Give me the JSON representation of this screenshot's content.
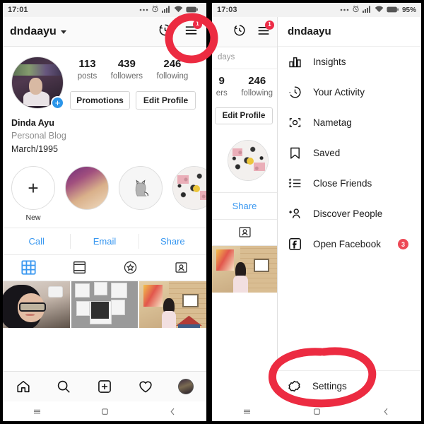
{
  "left_phone": {
    "status_bar": {
      "time": "17:01",
      "icons": [
        "dots-icon",
        "alarm-icon",
        "signal-icon",
        "wifi-icon",
        "battery-icon"
      ],
      "battery_pct": ""
    },
    "app_bar": {
      "username": "dndaayu",
      "caret_icon": "chevron-down-icon",
      "history_icon": "clock-history-icon",
      "menu_icon": "hamburger-menu-icon",
      "menu_badge": "1"
    },
    "profile": {
      "avatar_icon": "profile-avatar",
      "add_story_badge": "+",
      "stats": [
        {
          "value": "113",
          "label": "posts"
        },
        {
          "value": "439",
          "label": "followers"
        },
        {
          "value": "246",
          "label": "following"
        }
      ],
      "buttons": [
        {
          "label": "Promotions"
        },
        {
          "label": "Edit Profile"
        }
      ],
      "display_name": "Dinda Ayu",
      "category": "Personal Blog",
      "bio": "March/1995"
    },
    "highlights": [
      {
        "label": "New",
        "kind": "new"
      },
      {
        "label": "",
        "kind": "photo-purple"
      },
      {
        "label": "",
        "kind": "cat-drawing"
      },
      {
        "label": "",
        "kind": "speckle-collage"
      },
      {
        "label": "",
        "kind": "speckle-collage"
      }
    ],
    "contact_buttons": [
      {
        "label": "Call"
      },
      {
        "label": "Email"
      },
      {
        "label": "Share"
      }
    ],
    "tabs": [
      {
        "icon": "grid-icon",
        "active": true
      },
      {
        "icon": "feed-list-icon",
        "active": false
      },
      {
        "icon": "star-badge-icon",
        "active": false
      },
      {
        "icon": "tagged-person-icon",
        "active": false
      }
    ],
    "grid_posts": [
      {
        "alt": "selfie-photo",
        "has_multi_badge": true
      },
      {
        "alt": "polaroid-wall-photo",
        "has_multi_badge": false
      },
      {
        "alt": "gallery-room-photo",
        "has_multi_badge": false
      }
    ],
    "bottom_nav": [
      {
        "icon": "home-icon"
      },
      {
        "icon": "search-icon"
      },
      {
        "icon": "add-post-icon"
      },
      {
        "icon": "heart-activity-icon"
      },
      {
        "icon": "profile-avatar-icon"
      }
    ],
    "system_nav": [
      {
        "icon": "recents-icon"
      },
      {
        "icon": "home-square-icon"
      },
      {
        "icon": "back-icon"
      }
    ]
  },
  "right_phone": {
    "status_bar": {
      "time": "17:03",
      "icons": [
        "dots-icon",
        "alarm-icon",
        "signal-icon",
        "wifi-icon",
        "battery-icon"
      ],
      "battery_pct": "95%"
    },
    "peek": {
      "history_icon": "clock-history-icon",
      "menu_icon": "hamburger-menu-icon",
      "menu_badge": "1",
      "days_text": "days",
      "stat_partial_value": "9",
      "stat_partial_label": "ers",
      "stat_value": "246",
      "stat_label": "following",
      "edit_profile_label": "Edit Profile",
      "share_label": "Share",
      "tab_icon": "tagged-person-icon"
    },
    "drawer": {
      "header_username": "dndaayu",
      "items": [
        {
          "label": "Insights",
          "icon": "bar-chart-icon",
          "badge": ""
        },
        {
          "label": "Your Activity",
          "icon": "clock-activity-icon",
          "badge": ""
        },
        {
          "label": "Nametag",
          "icon": "nametag-icon",
          "badge": ""
        },
        {
          "label": "Saved",
          "icon": "bookmark-icon",
          "badge": ""
        },
        {
          "label": "Close Friends",
          "icon": "close-friends-list-icon",
          "badge": ""
        },
        {
          "label": "Discover People",
          "icon": "discover-people-icon",
          "badge": ""
        },
        {
          "label": "Open Facebook",
          "icon": "facebook-icon",
          "badge": "3"
        }
      ],
      "settings": {
        "label": "Settings",
        "icon": "settings-gear-icon"
      }
    },
    "system_nav": [
      {
        "icon": "recents-icon"
      },
      {
        "icon": "home-square-icon"
      },
      {
        "icon": "back-icon"
      }
    ]
  },
  "annotations": {
    "color": "#ec2b41",
    "shapes": [
      {
        "name": "circle-around-menu-icon",
        "target": "hamburger-menu-icon"
      },
      {
        "name": "circle-around-settings",
        "target": "settings-item"
      }
    ]
  },
  "theme": {
    "accent_blue": "#3897f0",
    "badge_red": "#ed4956",
    "annotation_red": "#ec2b41",
    "text_dark": "#1a1a1a",
    "text_muted": "#8e8e8e",
    "bg": "#ffffff",
    "bar_bg": "#fafafa"
  }
}
